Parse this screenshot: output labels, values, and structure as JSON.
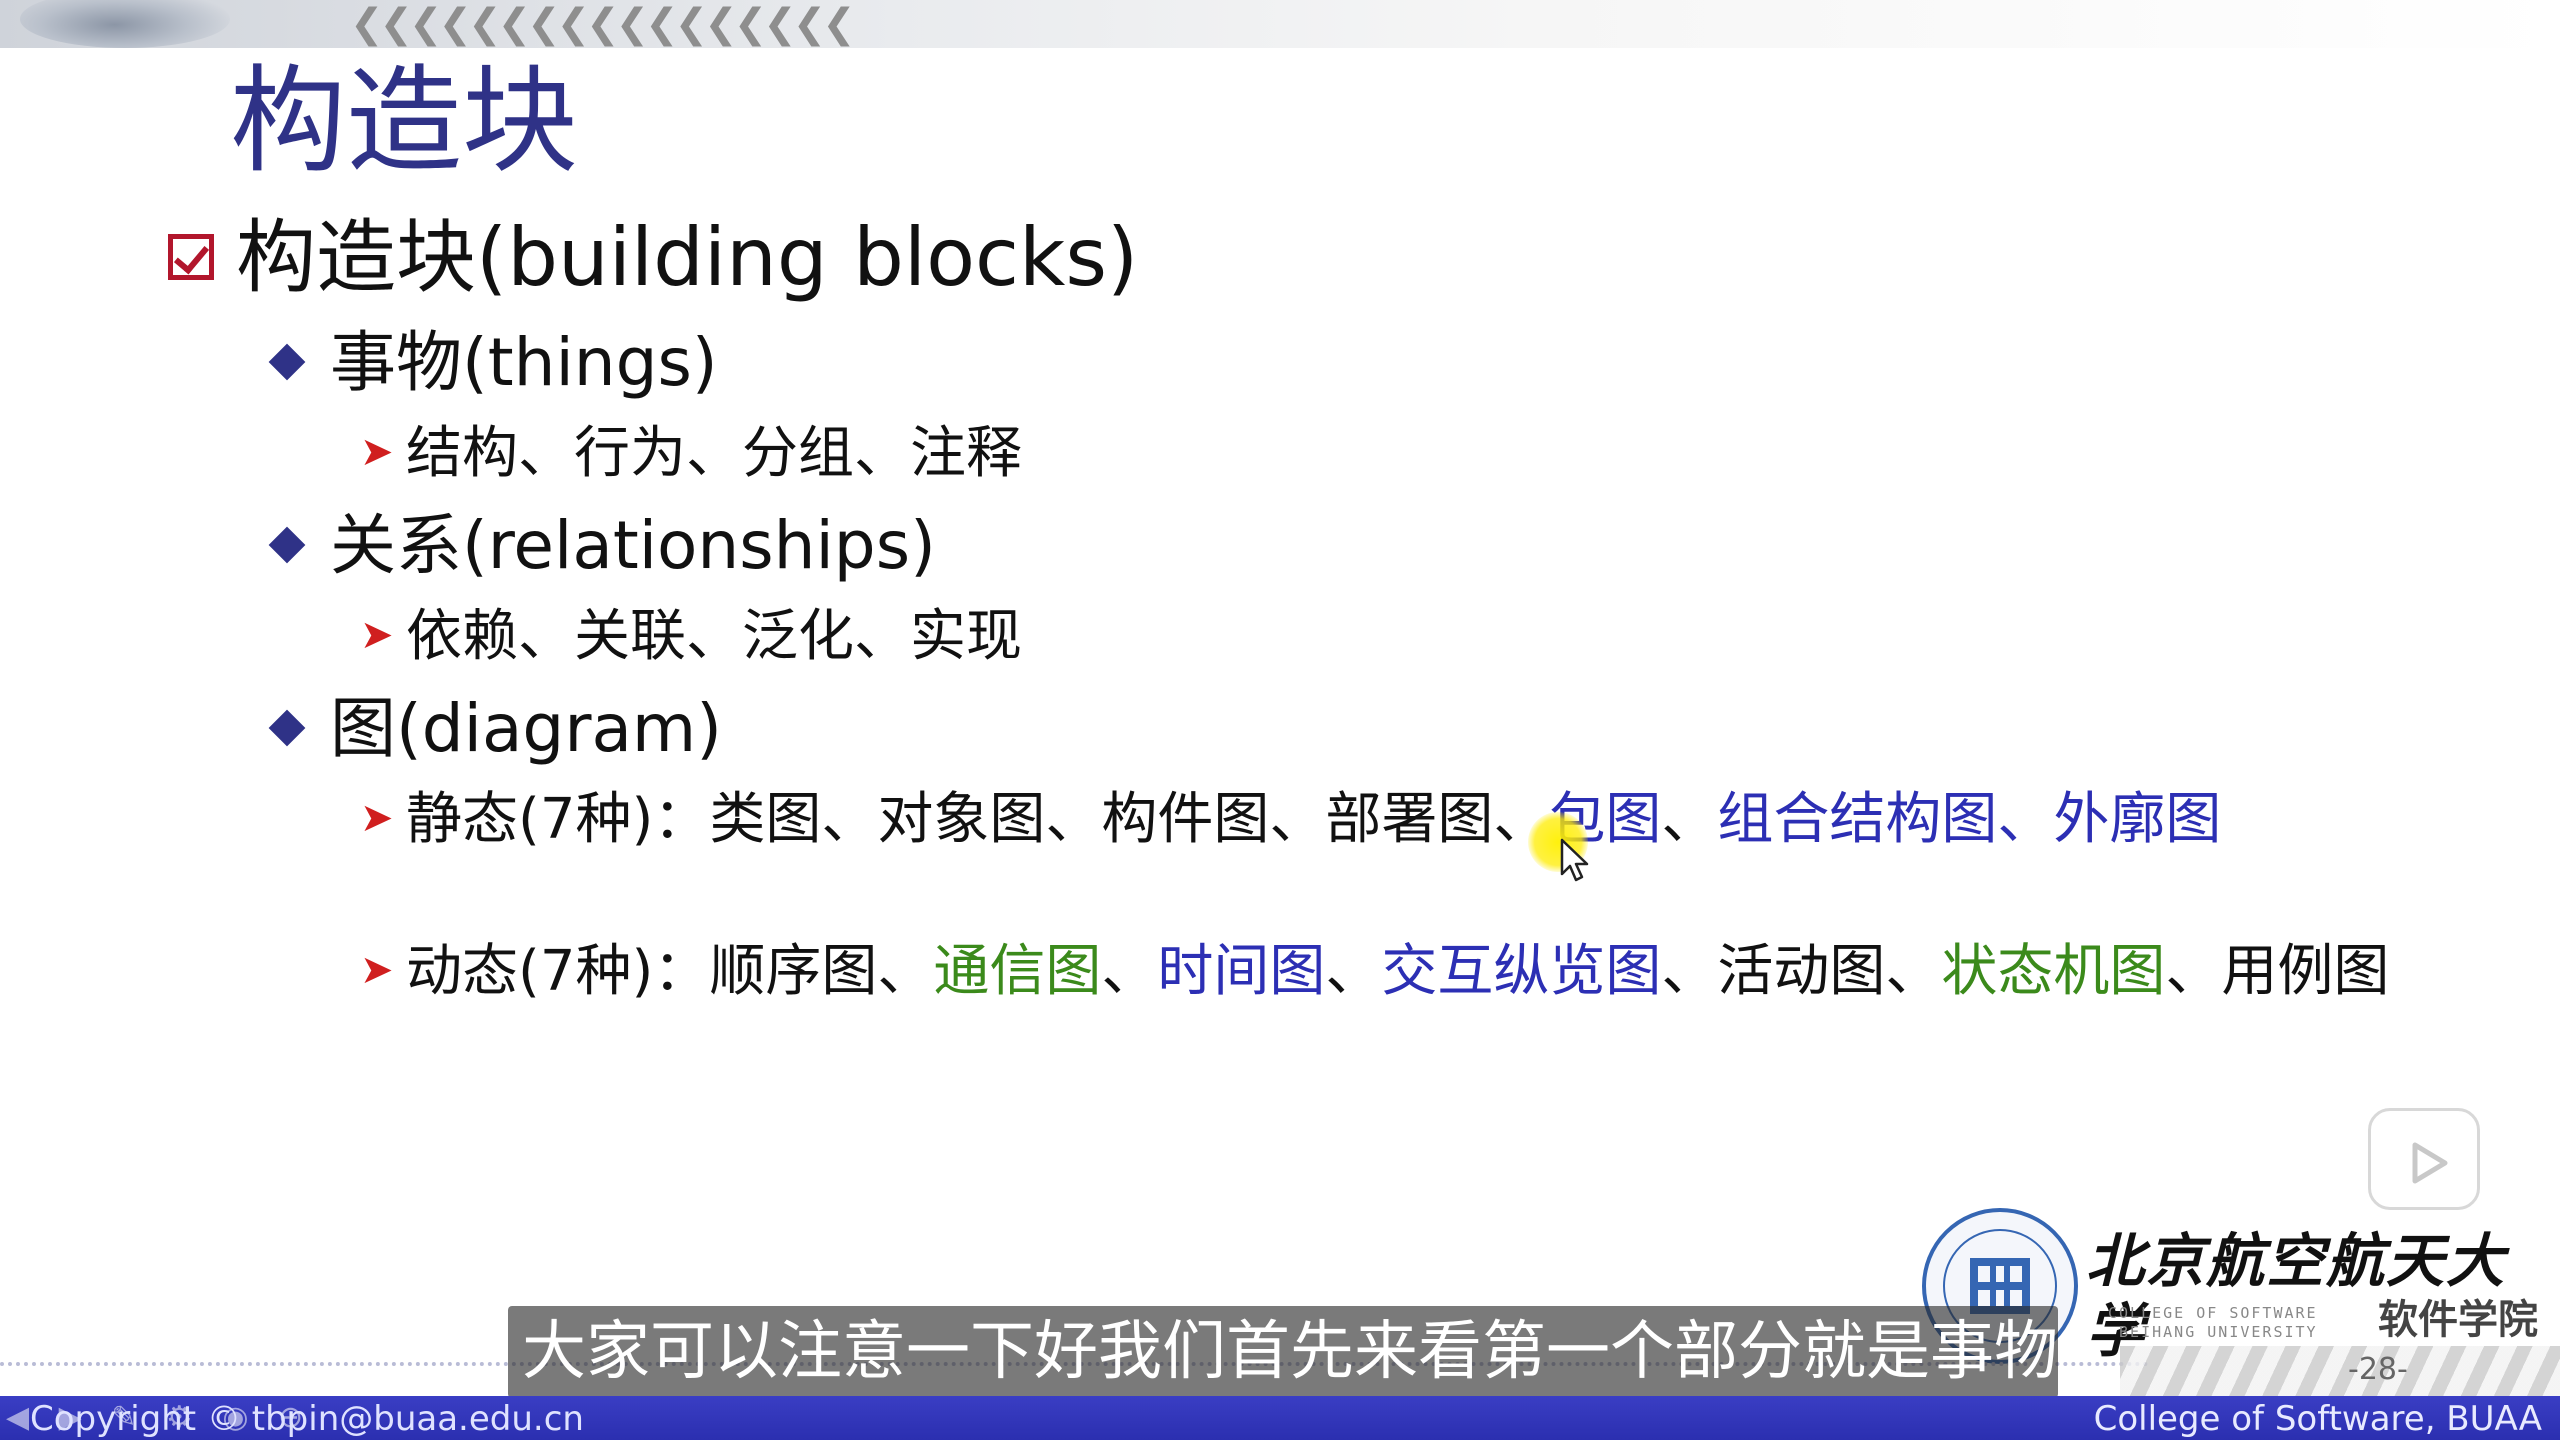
{
  "slide": {
    "title": "构造块",
    "level1": "构造块(building blocks)",
    "things": {
      "heading": "事物(things)",
      "items": "结构、行为、分组、注释"
    },
    "relationships": {
      "heading": "关系(relationships)",
      "items": "依赖、关联、泛化、实现"
    },
    "diagram": {
      "heading": "图(diagram)",
      "static": {
        "p1": "静态(7种)：类图、对象图、构件图、部署图、",
        "p2": "包图",
        "p3": "、",
        "p4": "组合结构图、外廓图"
      },
      "dynamic": {
        "p1": "动态(7种)：顺序图、",
        "p2": "通信图",
        "p3": "、",
        "p4": "时间图",
        "p5": "、",
        "p6": "交互纵览图",
        "p7": "、活动图、",
        "p8": "状态机图",
        "p9": "、用例图"
      }
    },
    "page_number": "-28-"
  },
  "logo": {
    "cn": "北京航空航天大学",
    "en_line1": "COLLEGE OF SOFTWARE",
    "en_line2": "BEIHANG UNIVERSITY",
    "dept": "软件学院"
  },
  "subtitle": "大家可以注意一下好我们首先来看第一个部分就是事物",
  "footer": {
    "left": "Copyright © tbpin@buaa.edu.cn",
    "right": "College of Software, BUAA"
  },
  "colors": {
    "title": "#2f3287",
    "blue_text": "#2c2fb4",
    "green_text": "#3b8a1b",
    "footer": "#2b2fb0",
    "bullet_arrow": "#d01f1f"
  },
  "icons": [
    "check-box-icon",
    "diamond-bullet-icon",
    "arrow-bullet-icon",
    "play-icon",
    "cursor-icon",
    "university-seal-icon"
  ]
}
